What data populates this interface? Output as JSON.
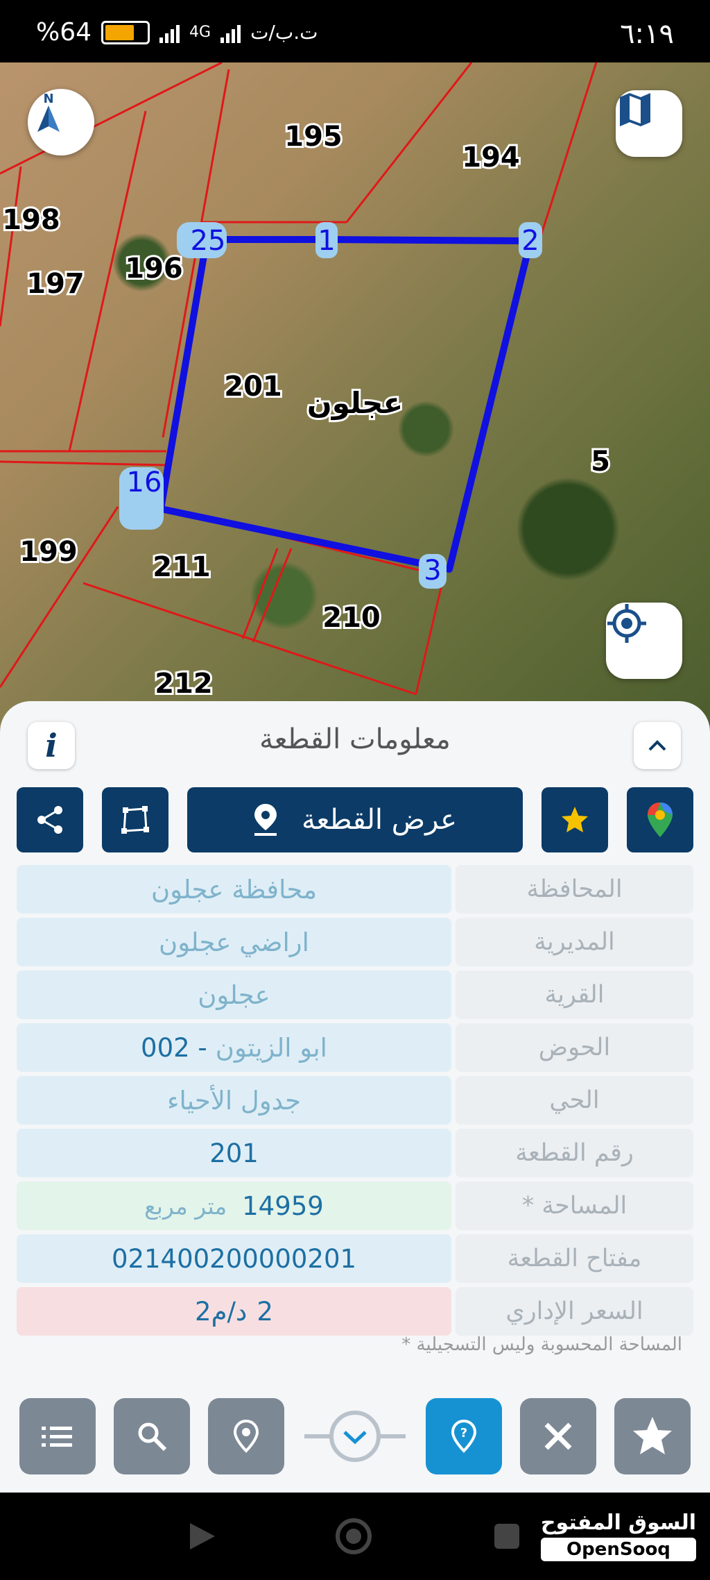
{
  "status_bar": {
    "time": "٦:١٩",
    "battery": "%64",
    "network": "4G",
    "carrier": "ت.ب/ت"
  },
  "map": {
    "parcel_labels": [
      "195",
      "194",
      "198",
      "197",
      "196",
      "201",
      "5",
      "199",
      "211",
      "210",
      "212"
    ],
    "locality_label": "عجلون",
    "vertex_labels": [
      "25",
      "1",
      "2",
      "16",
      "3"
    ],
    "compass_letter": "N",
    "colors": {
      "parcel_outline": "#1010e0",
      "boundaries": "#e01818",
      "vertex_fill": "#9ecff0"
    }
  },
  "sheet": {
    "title": "معلومات القطعة",
    "info_label": "i",
    "show_parcel_label": "عرض القطعة",
    "rows": [
      {
        "label": "المحافظة",
        "value": "محافظة عجلون"
      },
      {
        "label": "المديرية",
        "value": "اراضي عجلون"
      },
      {
        "label": "القرية",
        "value": "عجلون"
      },
      {
        "label": "الحوض",
        "value_name": "ابو الزيتون",
        "value_code": "002 -"
      },
      {
        "label": "الحي",
        "value": "جدول الأحياء"
      },
      {
        "label": "رقم القطعة",
        "value": "201"
      },
      {
        "label": "* المساحة",
        "value_number": "14959",
        "value_unit": "متر مربع"
      },
      {
        "label": "مفتاح القطعة",
        "value": "021400200000201"
      },
      {
        "label": "السعر الإداري",
        "value_price": "2",
        "value_unit": "د/م2"
      }
    ],
    "footnote": "* المساحة المحسوبة وليس التسجيلية"
  },
  "brand": {
    "arabic": "السوق المفتوح",
    "latin": "OpenSooq"
  }
}
